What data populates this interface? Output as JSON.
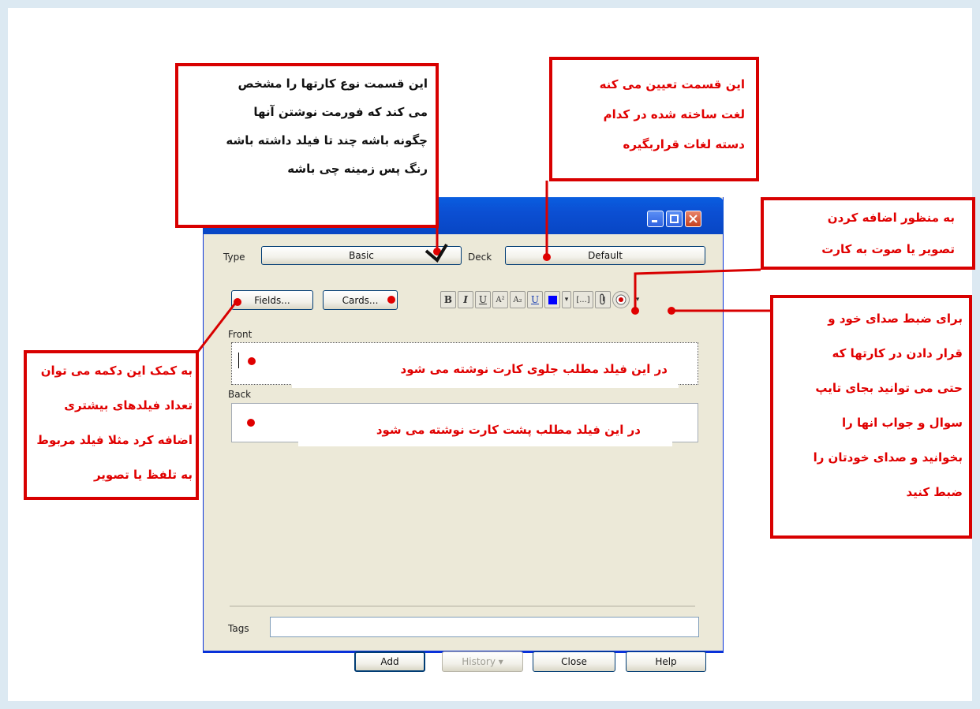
{
  "dialog": {
    "type_label": "Type",
    "type_value": "Basic",
    "deck_label": "Deck",
    "deck_value": "Default",
    "fields_button": "Fields...",
    "cards_button": "Cards...",
    "format_buttons": [
      "B",
      "I",
      "U",
      "A²",
      "A₂",
      "U",
      "",
      "▾",
      "[...]",
      "",
      "",
      "▾"
    ],
    "front_label": "Front",
    "back_label": "Back",
    "tags_label": "Tags",
    "tags_value": "",
    "add_button": "Add",
    "history_button": "History ▾",
    "close_button": "Close",
    "help_button": "Help",
    "colors": {
      "title_blue": "#0b4fd3",
      "dialog_bg": "#ece9d8",
      "highlight_red": "#e00000"
    }
  },
  "annotations": {
    "type_note": [
      "این قسمت نوع کارتها را مشخص",
      "می کند که فورمت نوشتن آنها",
      "چگونه باشه چند تا فیلد داشته باشه",
      "رنگ پس زمینه چی باشه"
    ],
    "deck_note": [
      "این قسمت تعیین می کنه",
      "لغت ساخته شده در کدام",
      "دسته لغات قراربگیره"
    ],
    "attach_note": [
      "به منظور اضافه کردن",
      "تصویر یا صوت به کارت"
    ],
    "record_note": [
      "برای ضبط صدای خود و",
      "قرار دادن در کارتها که",
      "حتی می توانید بجای تایپ",
      "سوال و جواب انها را",
      "بخوانید و صدای خودتان را",
      "ضبط کنید"
    ],
    "fields_note": [
      "به کمک این دکمه می توان",
      "تعداد فیلدهای بیشتری",
      "اضافه کرد مثلا فیلد مربوط",
      "به تلفظ یا تصویر"
    ],
    "front_note": "در این فیلد مطلب جلوی کارت نوشته می شود",
    "back_note": "در این فیلد مطلب پشت کارت نوشته می شود"
  }
}
